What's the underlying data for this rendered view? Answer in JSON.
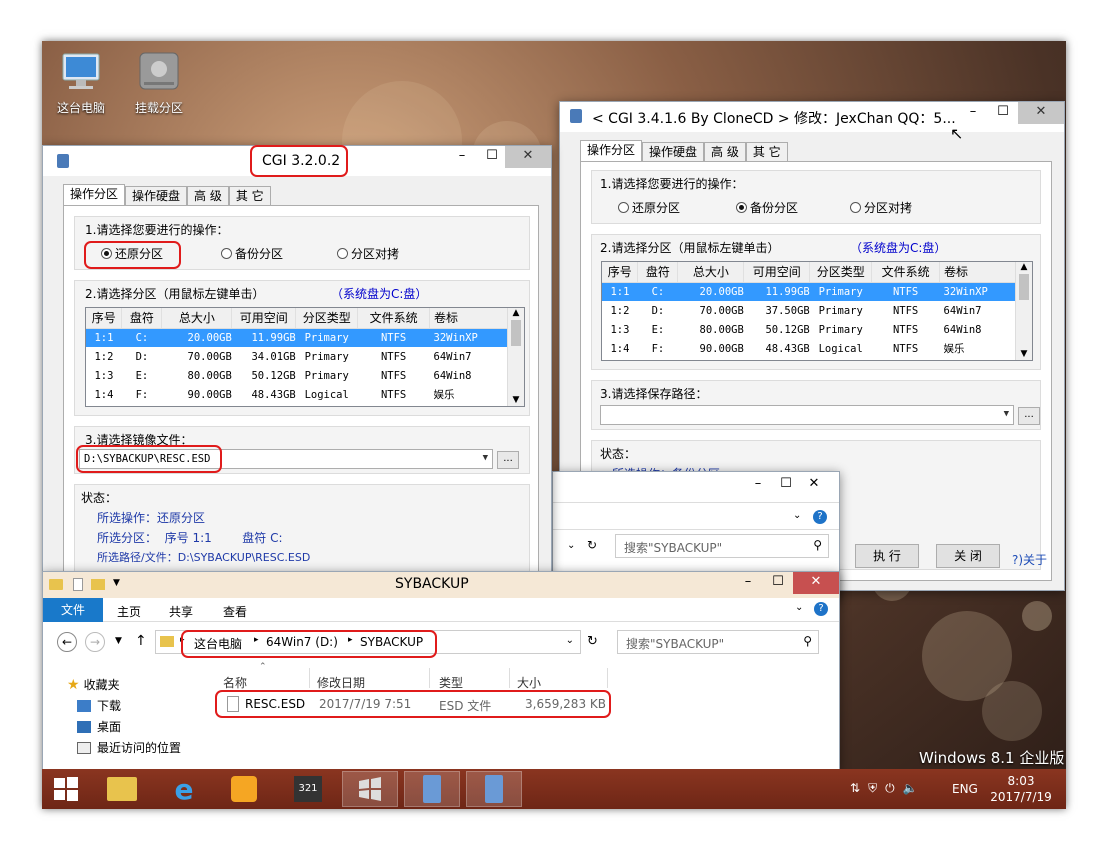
{
  "desktop": {
    "icons": [
      {
        "label": "这台电脑",
        "icon": "computer-icon"
      },
      {
        "label": "挂载分区",
        "icon": "drive-icon"
      }
    ],
    "watermark": "Windows 8.1 企业版"
  },
  "cgi_left": {
    "title": "CGI 3.2.0.2",
    "tabs": [
      "操作分区",
      "操作硬盘",
      "高 级",
      "其 它"
    ],
    "step1": "1.请选择您要进行的操作：",
    "radios": [
      "还原分区",
      "备份分区",
      "分区对拷"
    ],
    "selected_radio": "还原分区",
    "step2": "2.请选择分区（用鼠标左键单击）",
    "sysdisk": "（系统盘为C:盘）",
    "columns": [
      "序号",
      "盘符",
      "总大小",
      "可用空间",
      "分区类型",
      "文件系统",
      "卷标"
    ],
    "rows": [
      [
        "1:1",
        "C:",
        "20.00GB",
        "11.99GB",
        "Primary",
        "NTFS",
        "32WinXP"
      ],
      [
        "1:2",
        "D:",
        "70.00GB",
        "34.01GB",
        "Primary",
        "NTFS",
        "64Win7"
      ],
      [
        "1:3",
        "E:",
        "80.00GB",
        "50.12GB",
        "Primary",
        "NTFS",
        "64Win8"
      ],
      [
        "1:4",
        "F:",
        "90.00GB",
        "48.43GB",
        "Logical",
        "NTFS",
        "娱乐"
      ]
    ],
    "step3": "3.请选择镜像文件：",
    "image_path": "D:\\SYBACKUP\\RESC.ESD",
    "browse": "...",
    "status_label": "状态：",
    "status_lines": [
      "所选操作：还原分区",
      "所选分区：  序号 1:1        盘符 C:",
      "所选路径/文件：D:\\SYBACKUP\\RESC.ESD"
    ]
  },
  "cgi_right": {
    "title": "< CGI 3.4.1.6 By CloneCD > 修改：JexChan  QQ：5...",
    "tabs": [
      "操作分区",
      "操作硬盘",
      "高 级",
      "其 它"
    ],
    "step1": "1.请选择您要进行的操作：",
    "radios": [
      "还原分区",
      "备份分区",
      "分区对拷"
    ],
    "selected_radio": "备份分区",
    "step2": "2.请选择分区（用鼠标左键单击）",
    "sysdisk": "（系统盘为C:盘）",
    "columns": [
      "序号",
      "盘符",
      "总大小",
      "可用空间",
      "分区类型",
      "文件系统",
      "卷标"
    ],
    "rows": [
      [
        "1:1",
        "C:",
        "20.00GB",
        "11.99GB",
        "Primary",
        "NTFS",
        "32WinXP"
      ],
      [
        "1:2",
        "D:",
        "70.00GB",
        "37.50GB",
        "Primary",
        "NTFS",
        "64Win7"
      ],
      [
        "1:3",
        "E:",
        "80.00GB",
        "50.12GB",
        "Primary",
        "NTFS",
        "64Win8"
      ],
      [
        "1:4",
        "F:",
        "90.00GB",
        "48.43GB",
        "Logical",
        "NTFS",
        "娱乐"
      ]
    ],
    "step3": "3.请选择保存路径：",
    "save_path": "",
    "browse": "...",
    "status_label": "状态：",
    "status_line": "所选操作：备份分区",
    "execute": "执 行",
    "close": "关 闭",
    "about": "?)关于"
  },
  "explorer_back": {
    "search_placeholder": "搜索\"SYBACKUP\""
  },
  "explorer": {
    "title": "SYBACKUP",
    "ribbon_tabs": [
      "文件",
      "主页",
      "共享",
      "查看"
    ],
    "path": [
      "这台电脑",
      "64Win7 (D:)",
      "SYBACKUP"
    ],
    "search_placeholder": "搜索\"SYBACKUP\"",
    "nav": [
      {
        "label": "收藏夹",
        "icon": "star-icon"
      },
      {
        "label": "下载",
        "icon": "download-folder-icon"
      },
      {
        "label": "桌面",
        "icon": "desktop-folder-icon"
      },
      {
        "label": "最近访问的位置",
        "icon": "recent-places-icon"
      }
    ],
    "columns": [
      "名称",
      "修改日期",
      "类型",
      "大小"
    ],
    "files": [
      {
        "name": "RESC.ESD",
        "date": "2017/7/19 7:51",
        "type": "ESD 文件",
        "size": "3,659,283 KB"
      }
    ]
  },
  "taskbar": {
    "lang": "ENG",
    "time": "8:03",
    "date": "2017/7/19"
  }
}
